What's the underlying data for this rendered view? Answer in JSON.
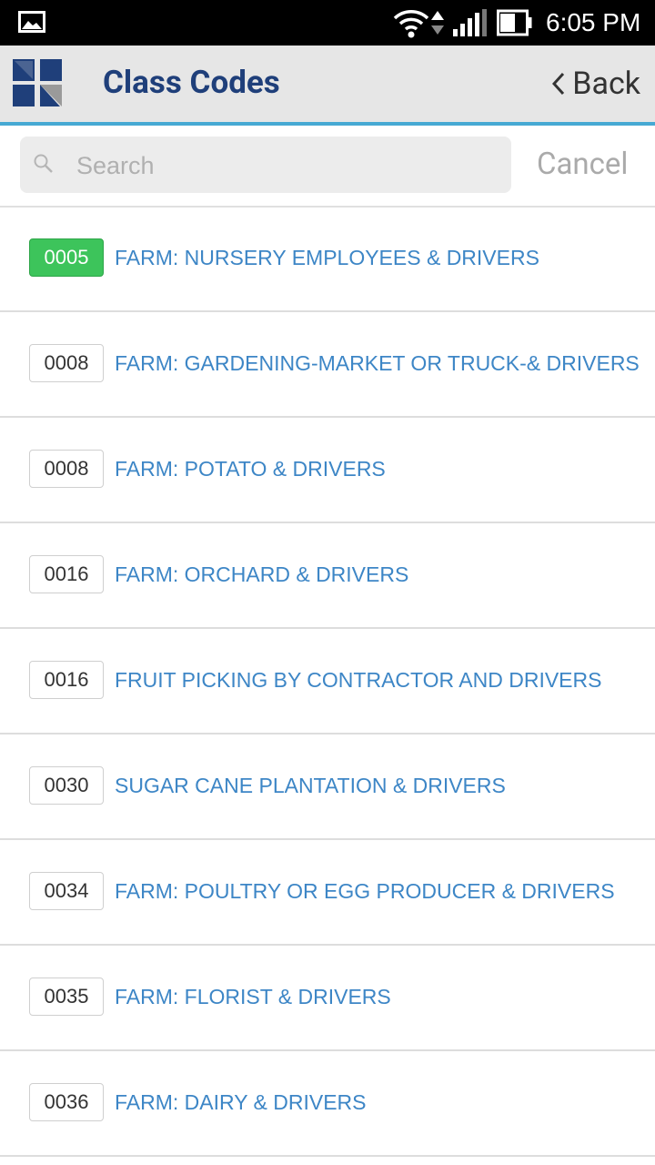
{
  "status_bar": {
    "time": "6:05 PM",
    "icons": [
      "image-icon",
      "wifi-icon",
      "data-arrows-icon",
      "signal-icon",
      "battery-icon"
    ]
  },
  "header": {
    "title": "Class Codes",
    "back_label": "Back",
    "logo": "company-logo"
  },
  "search": {
    "placeholder": "Search",
    "value": "",
    "cancel_label": "Cancel"
  },
  "colors": {
    "title": "#1f3f7a",
    "accent_line": "#46a9d3",
    "link": "#3d86c6",
    "selected_badge": "#3dc45b"
  },
  "items": [
    {
      "code": "0005",
      "label": "FARM: NURSERY EMPLOYEES & DRIVERS",
      "selected": true
    },
    {
      "code": "0008",
      "label": "FARM: GARDENING-MARKET OR TRUCK-& DRIVERS",
      "selected": false
    },
    {
      "code": "0008",
      "label": "FARM: POTATO & DRIVERS",
      "selected": false
    },
    {
      "code": "0016",
      "label": "FARM: ORCHARD & DRIVERS",
      "selected": false
    },
    {
      "code": "0016",
      "label": "FRUIT PICKING BY CONTRACTOR AND DRIVERS",
      "selected": false
    },
    {
      "code": "0030",
      "label": "SUGAR CANE PLANTATION & DRIVERS",
      "selected": false
    },
    {
      "code": "0034",
      "label": "FARM: POULTRY OR EGG PRODUCER & DRIVERS",
      "selected": false
    },
    {
      "code": "0035",
      "label": "FARM: FLORIST & DRIVERS",
      "selected": false
    },
    {
      "code": "0036",
      "label": "FARM: DAIRY & DRIVERS",
      "selected": false
    }
  ]
}
